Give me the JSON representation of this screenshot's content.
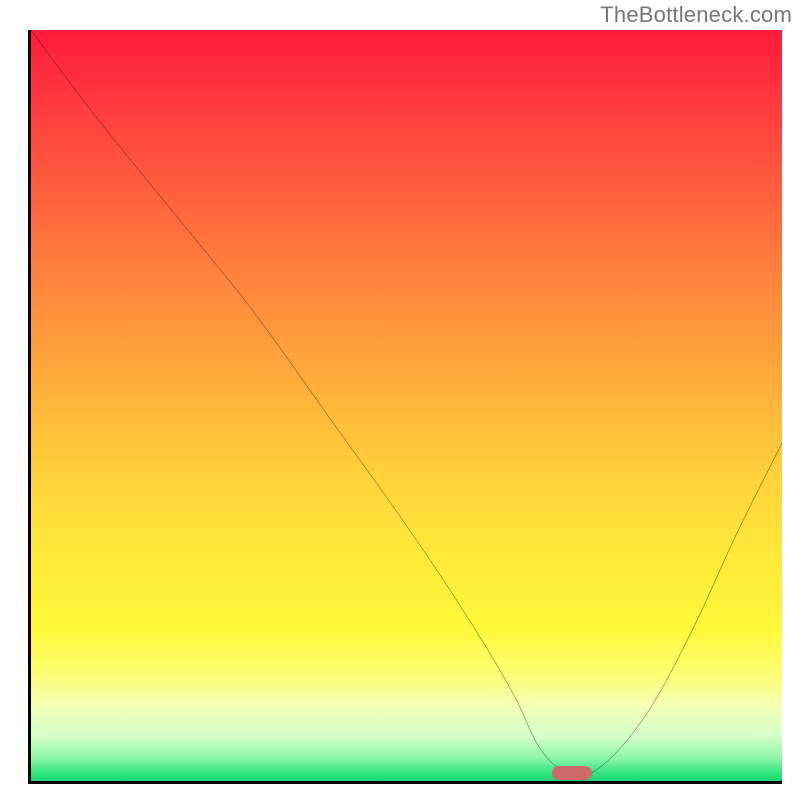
{
  "watermark": "TheBottleneck.com",
  "chart_data": {
    "type": "line",
    "title": "",
    "xlabel": "",
    "ylabel": "",
    "xlim": [
      0,
      100
    ],
    "ylim": [
      0,
      100
    ],
    "grid": false,
    "legend": false,
    "series": [
      {
        "name": "bottleneck-curve",
        "x": [
          0,
          9,
          22,
          30,
          40,
          50,
          58,
          64,
          68,
          72,
          76,
          82,
          88,
          94,
          100
        ],
        "values": [
          100,
          88,
          72,
          62,
          48,
          34,
          22,
          12,
          4,
          1,
          2,
          9,
          20,
          33,
          45
        ],
        "color": "#000000"
      }
    ],
    "annotation_marker": {
      "name": "optimal-point",
      "x": 72,
      "y": 1,
      "color": "#d06a6a"
    },
    "background_gradient": {
      "from": "#ff1a3c",
      "to": "#1fd271",
      "direction": "top-to-bottom"
    }
  }
}
